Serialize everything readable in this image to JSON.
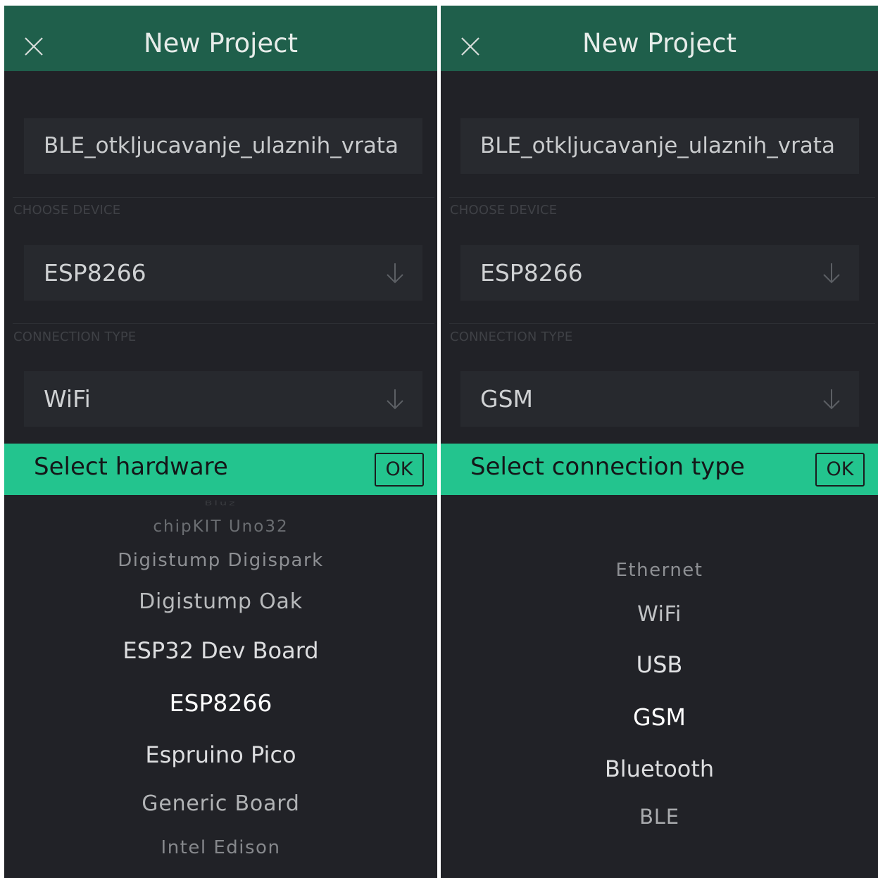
{
  "left": {
    "header": {
      "title": "New Project",
      "close_icon": "close-icon"
    },
    "project_name": "BLE_otkljucavanje_ulaznih_vrata",
    "device": {
      "label": "CHOOSE DEVICE",
      "value": "ESP8266",
      "icon": "arrow-down-icon"
    },
    "connection": {
      "label": "CONNECTION TYPE",
      "value": "WiFi",
      "icon": "arrow-down-icon"
    },
    "picker": {
      "title": "Select hardware",
      "ok_label": "OK",
      "options": [
        "Bluz",
        "chipKIT Uno32",
        "Digistump Digispark",
        "Digistump Oak",
        "ESP32 Dev Board",
        "ESP8266",
        "Espruino Pico",
        "Generic Board",
        "Intel Edison"
      ],
      "selected": "ESP8266"
    }
  },
  "right": {
    "header": {
      "title": "New Project",
      "close_icon": "close-icon"
    },
    "project_name": "BLE_otkljucavanje_ulaznih_vrata",
    "device": {
      "label": "CHOOSE DEVICE",
      "value": "ESP8266",
      "icon": "arrow-down-icon"
    },
    "connection": {
      "label": "CONNECTION TYPE",
      "value": "GSM",
      "icon": "arrow-down-icon"
    },
    "picker": {
      "title": "Select connection type",
      "ok_label": "OK",
      "options": [
        "Ethernet",
        "WiFi",
        "USB",
        "GSM",
        "Bluetooth",
        "BLE"
      ],
      "selected": "GSM"
    }
  },
  "colors": {
    "header_bg": "#1f5f4b",
    "accent": "#23c48e",
    "background": "#212227"
  }
}
